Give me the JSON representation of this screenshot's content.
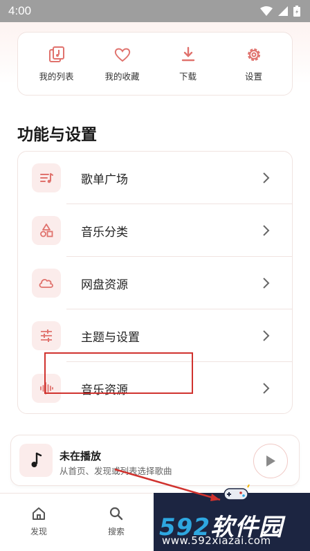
{
  "status_bar": {
    "time": "4:00"
  },
  "quick_actions": [
    {
      "label": "我的列表",
      "icon": "playlist-icon"
    },
    {
      "label": "我的收藏",
      "icon": "heart-icon"
    },
    {
      "label": "下载",
      "icon": "download-icon"
    },
    {
      "label": "设置",
      "icon": "gear-icon"
    }
  ],
  "section_title": "功能与设置",
  "menu": [
    {
      "label": "歌单广场",
      "icon": "playlist-square-icon"
    },
    {
      "label": "音乐分类",
      "icon": "category-shapes-icon"
    },
    {
      "label": "网盘资源",
      "icon": "cloud-icon"
    },
    {
      "label": "主题与设置",
      "icon": "sliders-icon"
    },
    {
      "label": "音乐资源",
      "icon": "waveform-icon"
    }
  ],
  "player": {
    "title": "未在播放",
    "subtitle": "从首页、发现或列表选择歌曲"
  },
  "tabs": [
    {
      "label": "发现",
      "icon": "home-icon"
    },
    {
      "label": "搜索",
      "icon": "search-icon"
    }
  ],
  "watermark": {
    "logo_number": "592",
    "logo_text": "软件园",
    "url": "www.592xiazai.com"
  },
  "colors": {
    "accent": "#e0726d",
    "icon_bg": "#fbeceb",
    "annotation_red": "#d0322e",
    "status_bar": "#9e9e9e"
  }
}
